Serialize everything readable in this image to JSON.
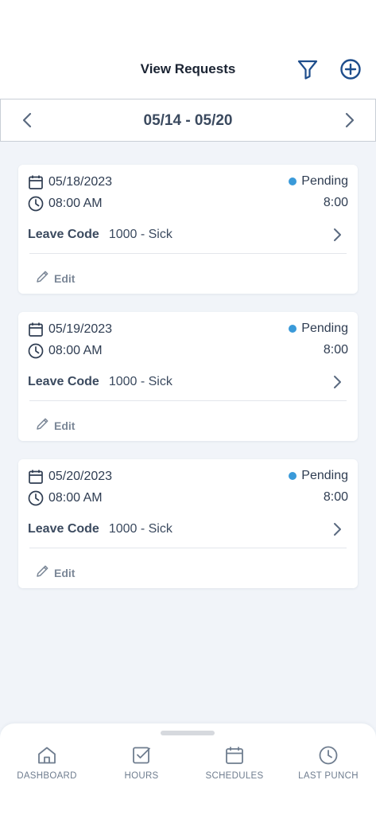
{
  "header": {
    "title": "View Requests",
    "filter_icon": "filter-icon",
    "add_icon": "add-circle-icon"
  },
  "week": {
    "range": "05/14 - 05/20",
    "prev_icon": "chevron-left-icon",
    "next_icon": "chevron-right-icon"
  },
  "requests": [
    {
      "date": "05/18/2023",
      "time": "08:00 AM",
      "status": "Pending",
      "hours": "8:00",
      "leave_label": "Leave Code",
      "leave_value": "1000 - Sick",
      "edit_label": "Edit"
    },
    {
      "date": "05/19/2023",
      "time": "08:00 AM",
      "status": "Pending",
      "hours": "8:00",
      "leave_label": "Leave Code",
      "leave_value": "1000 - Sick",
      "edit_label": "Edit"
    },
    {
      "date": "05/20/2023",
      "time": "08:00 AM",
      "status": "Pending",
      "hours": "8:00",
      "leave_label": "Leave Code",
      "leave_value": "1000 - Sick",
      "edit_label": "Edit"
    }
  ],
  "bottom_nav": {
    "items": [
      {
        "label": "DASHBOARD",
        "icon": "home-icon"
      },
      {
        "label": "HOURS",
        "icon": "checkbox-icon"
      },
      {
        "label": "SCHEDULES",
        "icon": "calendar-icon"
      },
      {
        "label": "LAST PUNCH",
        "icon": "clock-icon"
      }
    ]
  },
  "colors": {
    "accent": "#1f4e8c",
    "status_pending": "#3a9ad9",
    "background": "#f1f4f9",
    "text": "#2f3d52"
  }
}
